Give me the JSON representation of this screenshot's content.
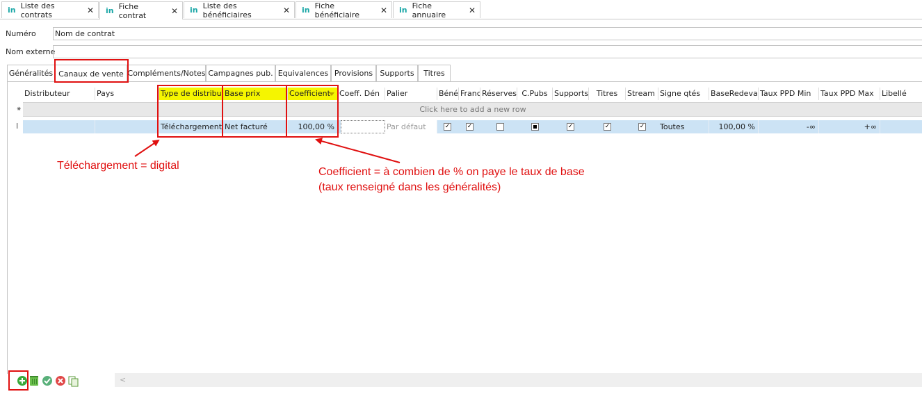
{
  "doc_tabs": [
    {
      "label": "Liste des contrats",
      "icon": "in",
      "active": false
    },
    {
      "label": "Fiche contrat",
      "icon": "in",
      "active": true
    },
    {
      "label": "Liste des bénéficiaires",
      "icon": "in",
      "active": false
    },
    {
      "label": "Fiche bénéficiaire",
      "icon": "in",
      "active": false
    },
    {
      "label": "Fiche annuaire",
      "icon": "in",
      "active": false
    }
  ],
  "close_glyph": "✕",
  "form": {
    "numero_label": "Numéro",
    "numero_value": "Nom de contrat",
    "nom_externe_label": "Nom externe",
    "nom_externe_value": ""
  },
  "inner_tabs": [
    "Généralités",
    "Canaux de vente",
    "Compléments/Notes",
    "Campagnes pub.",
    "Equivalences",
    "Provisions",
    "Supports",
    "Titres"
  ],
  "active_inner_tab": "Canaux de vente",
  "grid": {
    "columns": [
      "Distributeur",
      "Pays",
      "Type de distribute",
      "Base prix",
      "Coefficient",
      "Coeff. Dén",
      "Palier",
      "Bénéf",
      "Franc",
      "Réserves",
      "C.Pubs",
      "Supports",
      "Titres",
      "Stream",
      "Signe qtés",
      "BaseRedevan",
      "Taux PPD Min",
      "Taux PPD Max",
      "Libellé"
    ],
    "new_row_indicator": "⁕",
    "new_row_text": "Click here to add a new row",
    "row_indicator": "I",
    "row": {
      "distributeur": "",
      "pays": "",
      "type_distribution": "Téléchargement",
      "base_prix": "Net facturé",
      "coefficient": "100,00 %",
      "coeff_den": "",
      "palier": "Par défaut",
      "benef": true,
      "franc": true,
      "reserves": false,
      "cpubs": "indeterminate",
      "supports": true,
      "titres": true,
      "stream": true,
      "signe_qtes": "Toutes",
      "base_redevance": "100,00 %",
      "taux_ppd_min": "-∞",
      "taux_ppd_max": "+∞",
      "libelle": ""
    }
  },
  "annotations": {
    "type_note": "Téléchargement = digital",
    "coef_note_line1": "Coefficient = à combien de % on paye le taux de base",
    "coef_note_line2": "(taux renseigné dans les généralités)",
    "color": "#e01010"
  },
  "toolbar": {
    "icons": [
      "add-icon",
      "delete-icon",
      "validate-icon",
      "cancel-icon",
      "copy-icon"
    ]
  },
  "scroll_left_glyph": "<"
}
